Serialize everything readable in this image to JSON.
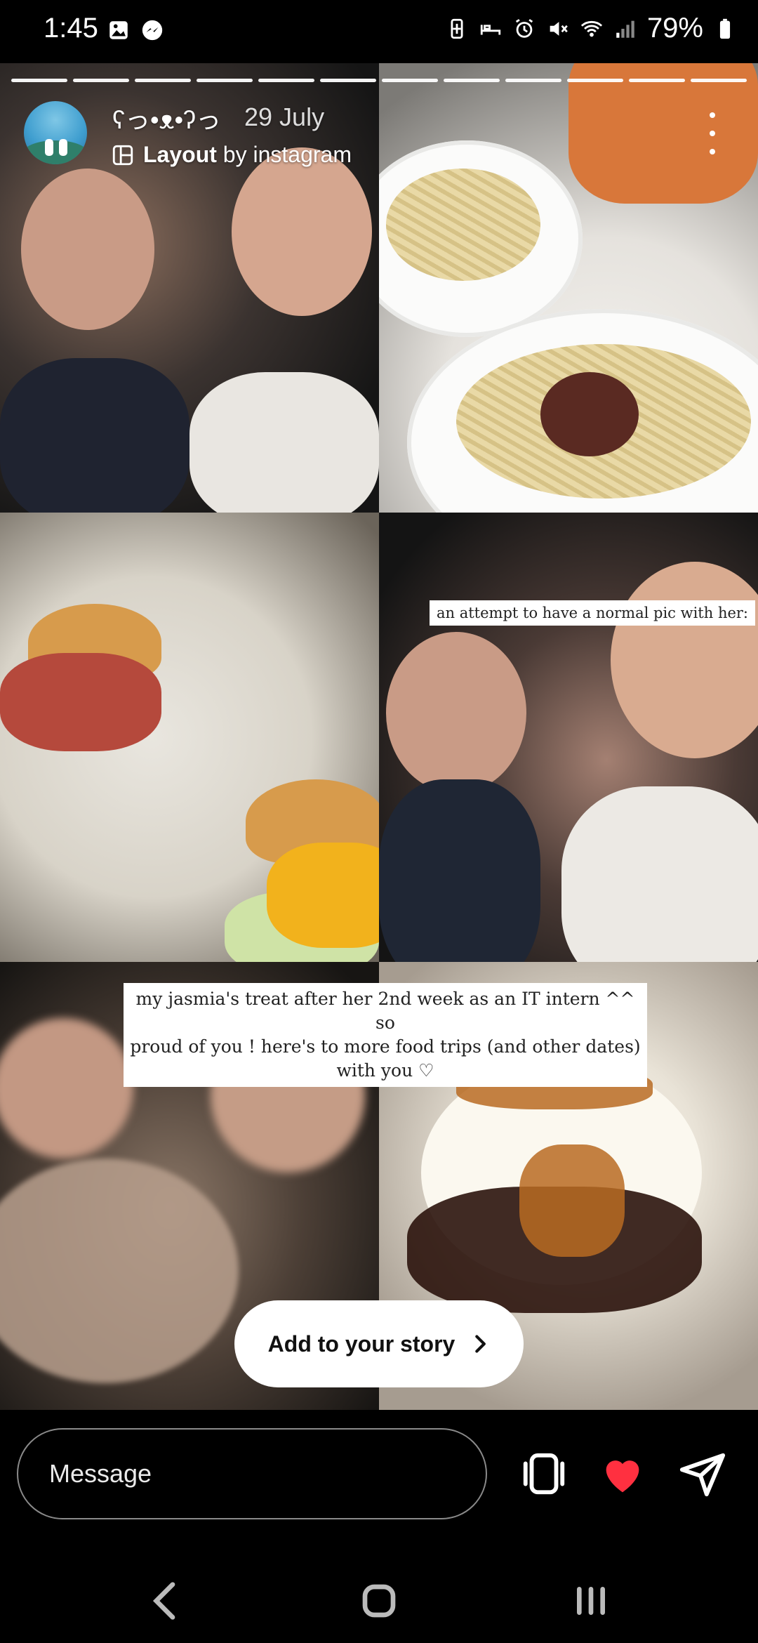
{
  "status_bar": {
    "time": "1:45",
    "battery": "79%",
    "left_icons": [
      "gallery-icon",
      "messenger-icon"
    ],
    "right_icons": [
      "battery-saver-icon",
      "sleep-icon",
      "alarm-icon",
      "mute-icon",
      "wifi-icon",
      "signal-icon",
      "battery-icon"
    ]
  },
  "story": {
    "segments": 12,
    "username": "ʕっ•ᴥ•ʔっ",
    "date": "29 July",
    "attribution_brand": "Layout",
    "attribution_by": "by instagram",
    "note_top": "an attempt to have a normal pic with her:",
    "caption_lines": [
      "my jasmia's treat after her 2nd week as an IT intern ^^ so",
      "proud of you ! here's to more food trips (and other dates)",
      "with you ♡"
    ],
    "add_to_story_label": "Add to your story"
  },
  "bottom_bar": {
    "message_placeholder": "Message"
  },
  "colors": {
    "background": "#000000",
    "like": "#ff3040"
  }
}
